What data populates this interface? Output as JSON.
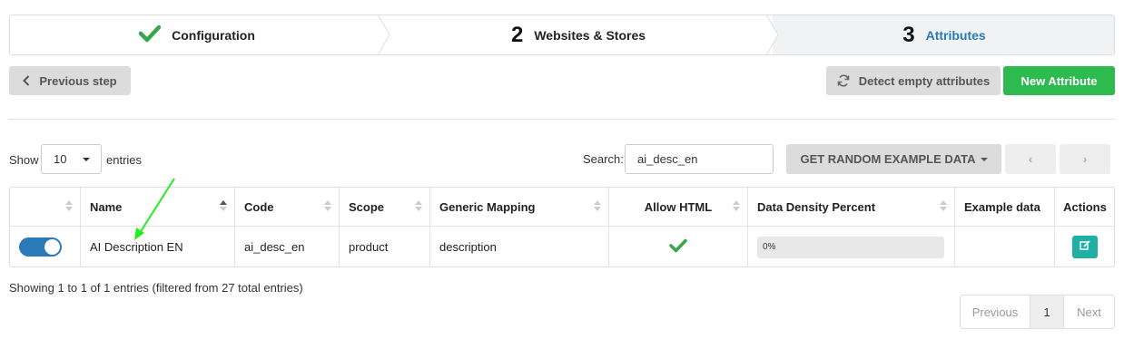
{
  "wizard": {
    "steps": [
      {
        "number": "",
        "label": "Configuration",
        "state": "done"
      },
      {
        "number": "2",
        "label": "Websites & Stores",
        "state": "done"
      },
      {
        "number": "3",
        "label": "Attributes",
        "state": "active"
      }
    ]
  },
  "toolbar": {
    "previous_label": "Previous step",
    "detect_label": "Detect empty attributes",
    "new_label": "New Attribute"
  },
  "filters": {
    "show_label": "Show",
    "show_value": "10",
    "entries_label": "entries",
    "search_label": "Search:",
    "search_value": "ai_desc_en",
    "random_label": "GET RANDOM EXAMPLE DATA",
    "prev_arrow": "‹",
    "next_arrow": "›"
  },
  "table": {
    "headers": [
      "",
      "Name",
      "Code",
      "Scope",
      "Generic Mapping",
      "Allow HTML",
      "Data Density Percent",
      "Example data",
      "Actions"
    ],
    "rows": [
      {
        "enabled": true,
        "name": "AI Description EN",
        "code": "ai_desc_en",
        "scope": "product",
        "mapping": "description",
        "allow_html": true,
        "density": "0%",
        "example": ""
      }
    ]
  },
  "footer": {
    "info": "Showing 1 to 1 of 1 entries (filtered from 27 total entries)",
    "prev": "Previous",
    "page": "1",
    "next": "Next"
  },
  "colors": {
    "primary": "#2a7ab8",
    "success": "#2dba4e",
    "teal": "#1fb0a3",
    "check": "#3aa64a",
    "annotation_arrow": "#22ee22"
  }
}
